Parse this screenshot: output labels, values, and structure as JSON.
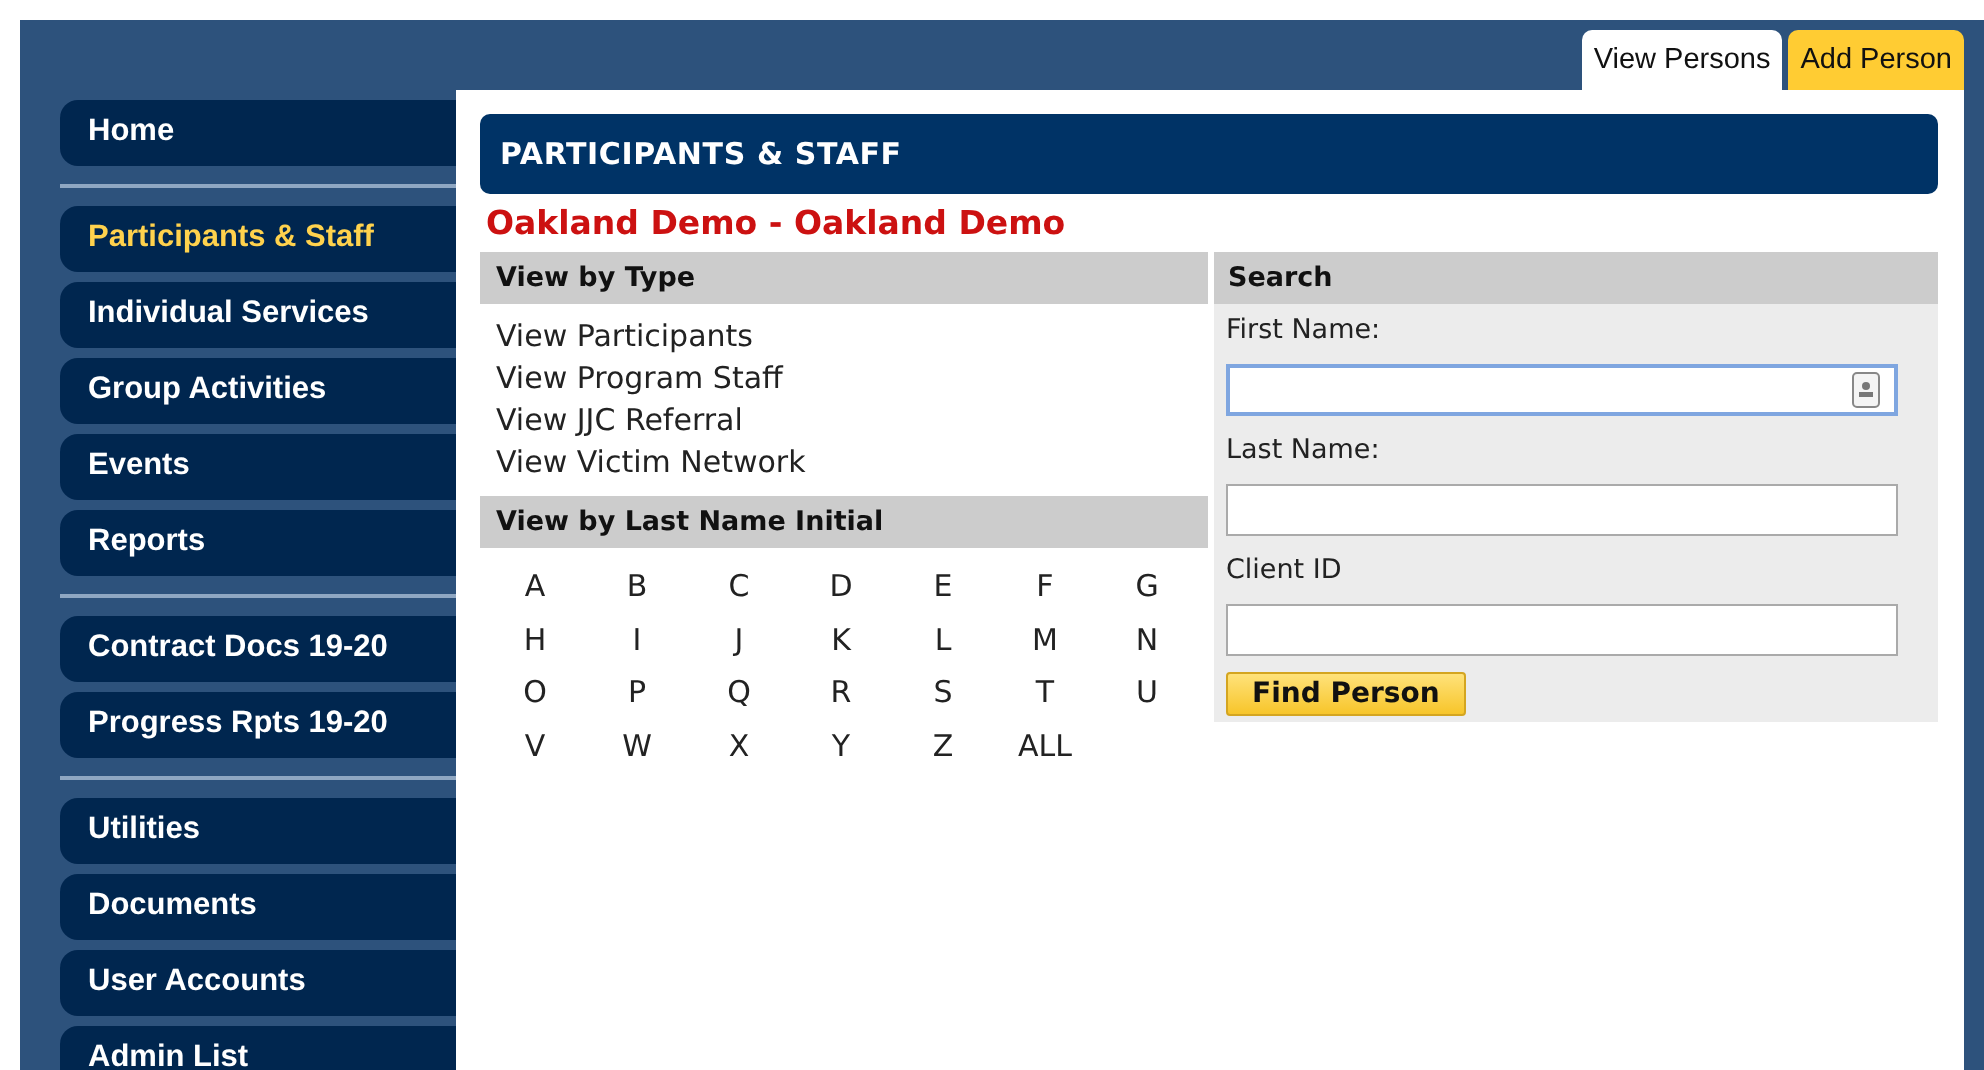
{
  "tabs": [
    {
      "label": "View Persons",
      "selected": true
    },
    {
      "label": "Add Person",
      "selected": false
    }
  ],
  "sidebar": {
    "groups": [
      {
        "items": [
          {
            "label": "Home",
            "selected": false
          }
        ]
      },
      {
        "items": [
          {
            "label": "Participants & Staff",
            "selected": true
          },
          {
            "label": "Individual Services",
            "selected": false
          },
          {
            "label": "Group Activities",
            "selected": false
          },
          {
            "label": "Events",
            "selected": false
          },
          {
            "label": "Reports",
            "selected": false
          }
        ]
      },
      {
        "items": [
          {
            "label": "Contract Docs 19-20",
            "selected": false
          },
          {
            "label": "Progress Rpts 19-20",
            "selected": false
          }
        ]
      },
      {
        "items": [
          {
            "label": "Utilities",
            "selected": false
          },
          {
            "label": "Documents",
            "selected": false
          },
          {
            "label": "User Accounts",
            "selected": false
          },
          {
            "label": "Admin List",
            "selected": false
          }
        ]
      }
    ]
  },
  "page_title": "PARTICIPANTS & STAFF",
  "organization": "Oakland Demo - Oakland Demo",
  "view_by_type": {
    "heading": "View by Type",
    "links": [
      "View Participants",
      "View Program Staff",
      "View JJC Referral",
      "View Victim Network"
    ]
  },
  "view_by_initial": {
    "heading": "View by Last Name Initial",
    "letters": [
      "A",
      "B",
      "C",
      "D",
      "E",
      "F",
      "G",
      "H",
      "I",
      "J",
      "K",
      "L",
      "M",
      "N",
      "O",
      "P",
      "Q",
      "R",
      "S",
      "T",
      "U",
      "V",
      "W",
      "X",
      "Y",
      "Z",
      "ALL"
    ]
  },
  "search": {
    "heading": "Search",
    "fields": [
      {
        "label": "First Name:",
        "focused": true,
        "contact_icon": true
      },
      {
        "label": "Last Name:",
        "focused": false,
        "contact_icon": false
      },
      {
        "label": "Client ID",
        "focused": false,
        "contact_icon": false
      }
    ],
    "button": "Find Person"
  }
}
